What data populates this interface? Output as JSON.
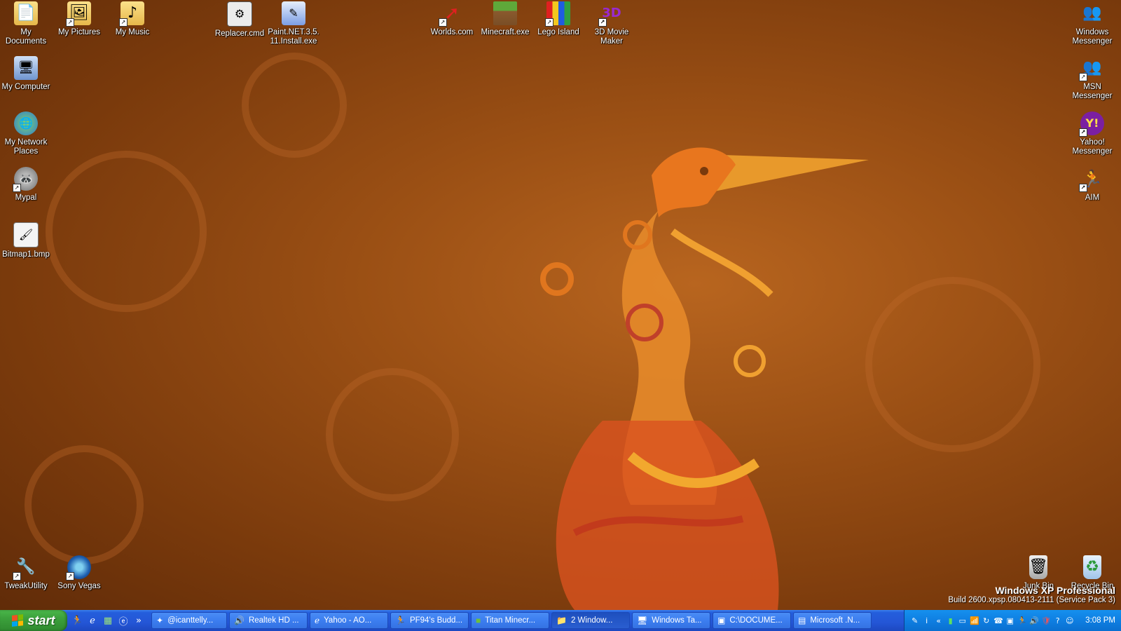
{
  "desktop": {
    "icons_left": [
      {
        "label": "My Documents",
        "icon": "folder-documents-icon"
      },
      {
        "label": "My Pictures",
        "icon": "folder-pictures-icon"
      },
      {
        "label": "My Music",
        "icon": "folder-music-icon"
      },
      {
        "label": "Replacer.cmd",
        "icon": "cmd-script-icon"
      },
      {
        "label": "Paint.NET.3.5.11.Install.exe",
        "icon": "installer-icon"
      },
      {
        "label": "Worlds.com",
        "icon": "worlds-icon"
      },
      {
        "label": "Minecraft.exe",
        "icon": "minecraft-icon"
      },
      {
        "label": "Lego Island",
        "icon": "lego-island-icon"
      },
      {
        "label": "3D Movie Maker",
        "icon": "movie-maker-icon"
      },
      {
        "label": "My Computer",
        "icon": "computer-icon"
      },
      {
        "label": "My Network Places",
        "icon": "network-icon"
      },
      {
        "label": "Mypal",
        "icon": "mypal-browser-icon"
      },
      {
        "label": "Bitmap1.bmp",
        "icon": "bitmap-file-icon"
      },
      {
        "label": "TweakUtility",
        "icon": "wrench-icon"
      },
      {
        "label": "Sony Vegas",
        "icon": "vegas-icon"
      }
    ],
    "icons_right": [
      {
        "label": "Windows Messenger",
        "icon": "windows-messenger-icon"
      },
      {
        "label": "MSN Messenger",
        "icon": "msn-messenger-icon"
      },
      {
        "label": "Yahoo! Messenger",
        "icon": "yahoo-messenger-icon"
      },
      {
        "label": "AIM",
        "icon": "aim-icon"
      },
      {
        "label": "Junk Bin",
        "icon": "junk-bin-icon"
      },
      {
        "label": "Recycle Bin",
        "icon": "recycle-bin-icon"
      }
    ]
  },
  "watermark": {
    "product": "Windows XP Professional",
    "build": "Build 2600.xpsp.080413-2111 (Service Pack 3)"
  },
  "taskbar": {
    "start_label": "start",
    "quick_launch_more": "»",
    "tasks": [
      {
        "label": "@icanttelly...",
        "icon": "app-icon"
      },
      {
        "label": "Realtek HD ...",
        "icon": "speaker-icon"
      },
      {
        "label": "Yahoo - AO...",
        "icon": "browser-icon"
      },
      {
        "label": "PF94's Budd...",
        "icon": "aim-buddy-icon"
      },
      {
        "label": "Titan Minecr...",
        "icon": "minecraft-icon"
      },
      {
        "label": "2 Window...",
        "icon": "folder-icon"
      },
      {
        "label": "Windows Ta...",
        "icon": "task-manager-icon"
      },
      {
        "label": "C:\\DOCUME...",
        "icon": "console-icon"
      },
      {
        "label": "Microsoft .N...",
        "icon": "dotnet-icon"
      }
    ],
    "clock": "3:08 PM"
  },
  "colors": {
    "taskbar_blue": "#245edc",
    "start_green": "#3ca03c",
    "tray_blue": "#0f7fe2",
    "wallpaper_orange": "#9a4f14"
  }
}
